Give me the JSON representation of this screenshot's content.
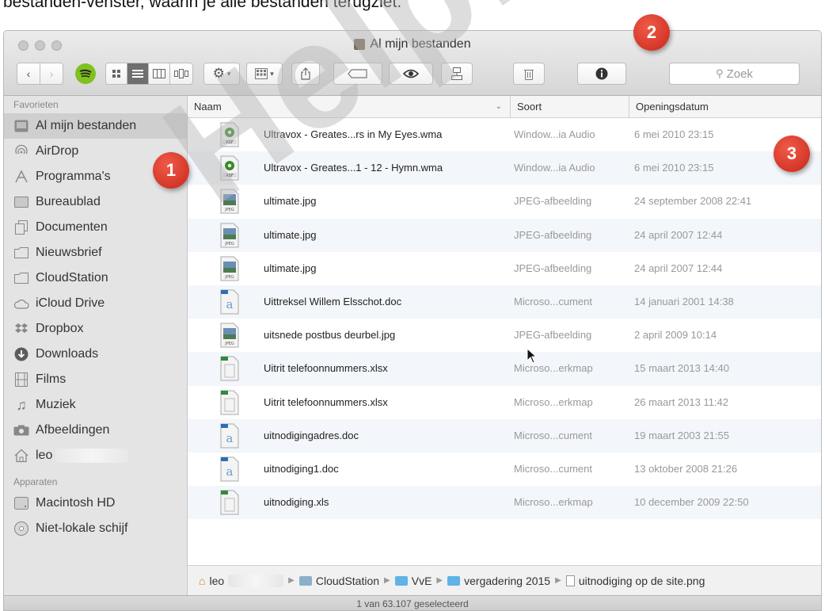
{
  "document": {
    "caption": "bestanden-venster, waarin je alle bestanden terugziet."
  },
  "window": {
    "title": "Al mijn bestanden"
  },
  "toolbar": {
    "search_placeholder": "Zoek",
    "icons": [
      "back-icon",
      "forward-icon",
      "spotify-icon",
      "icon-view-icon",
      "list-view-icon",
      "column-view-icon",
      "coverflow-view-icon",
      "gear-icon",
      "arrange-icon",
      "share-icon",
      "tag-icon",
      "quicklook-eye-icon",
      "connect-icon",
      "trash-icon",
      "info-icon",
      "search-icon"
    ]
  },
  "sidebar": {
    "favorites_header": "Favorieten",
    "favorites": [
      {
        "label": "Al mijn bestanden",
        "icon": "all-files-icon",
        "selected": true
      },
      {
        "label": "AirDrop",
        "icon": "airdrop-icon"
      },
      {
        "label": "Programma's",
        "icon": "applications-icon"
      },
      {
        "label": "Bureaublad",
        "icon": "desktop-icon"
      },
      {
        "label": "Documenten",
        "icon": "documents-icon"
      },
      {
        "label": "Nieuwsbrief",
        "icon": "folder-icon"
      },
      {
        "label": "CloudStation",
        "icon": "folder-icon"
      },
      {
        "label": "iCloud Drive",
        "icon": "icloud-icon"
      },
      {
        "label": "Dropbox",
        "icon": "dropbox-icon"
      },
      {
        "label": "Downloads",
        "icon": "downloads-icon"
      },
      {
        "label": "Films",
        "icon": "movies-icon"
      },
      {
        "label": "Muziek",
        "icon": "music-icon"
      },
      {
        "label": "Afbeeldingen",
        "icon": "pictures-icon"
      },
      {
        "label": "leo",
        "icon": "home-icon"
      }
    ],
    "devices_header": "Apparaten",
    "devices": [
      {
        "label": "Macintosh HD",
        "icon": "harddisk-icon"
      },
      {
        "label": "Niet-lokale schijf",
        "icon": "remote-disc-icon"
      }
    ]
  },
  "columns": {
    "name": "Naam",
    "kind": "Soort",
    "date": "Openingsdatum"
  },
  "files": [
    {
      "name": "Ultravox - Greates...rs in My Eyes.wma",
      "kind": "Window...ia Audio",
      "date": "6 mei 2010 23:15",
      "icon": "asf"
    },
    {
      "name": "Ultravox - Greates...1 - 12 - Hymn.wma",
      "kind": "Window...ia Audio",
      "date": "6 mei 2010 23:15",
      "icon": "asf"
    },
    {
      "name": "ultimate.jpg",
      "kind": "JPEG-afbeelding",
      "date": "24 september 2008 22:41",
      "icon": "jpeg"
    },
    {
      "name": "ultimate.jpg",
      "kind": "JPEG-afbeelding",
      "date": "24 april 2007 12:44",
      "icon": "jpeg"
    },
    {
      "name": "ultimate.jpg",
      "kind": "JPEG-afbeelding",
      "date": "24 april 2007 12:44",
      "icon": "jpeg"
    },
    {
      "name": "Uittreksel Willem Elsschot.doc",
      "kind": "Microso...cument",
      "date": "14 januari 2001 14:38",
      "icon": "doc"
    },
    {
      "name": "uitsnede  postbus deurbel.jpg",
      "kind": "JPEG-afbeelding",
      "date": "2 april 2009 10:14",
      "icon": "jpeg"
    },
    {
      "name": "Uitrit telefoonnummers.xlsx",
      "kind": "Microso...erkmap",
      "date": "15 maart 2013 14:40",
      "icon": "xls"
    },
    {
      "name": "Uitrit telefoonnummers.xlsx",
      "kind": "Microso...erkmap",
      "date": "26 maart 2013 11:42",
      "icon": "xls"
    },
    {
      "name": "uitnodigingadres.doc",
      "kind": "Microso...cument",
      "date": "19 maart 2003 21:55",
      "icon": "doc"
    },
    {
      "name": "uitnodiging1.doc",
      "kind": "Microso...cument",
      "date": "13 oktober 2008 21:26",
      "icon": "doc"
    },
    {
      "name": "uitnodiging.xls",
      "kind": "Microso...erkmap",
      "date": "10 december 2009 22:50",
      "icon": "xls"
    }
  ],
  "pathbar": {
    "home": "leo",
    "crumbs": [
      "CloudStation",
      "VvE",
      "vergadering 2015",
      "uitnodiging op de site.png"
    ]
  },
  "status": "1 van 63.107 geselecteerd",
  "badges": [
    "1",
    "2",
    "3"
  ],
  "watermark": "Help!",
  "colors": {
    "badge_red": "#d9392a",
    "selection_gray": "#cfcfcf",
    "folder_blue": "#5fb3e6"
  }
}
